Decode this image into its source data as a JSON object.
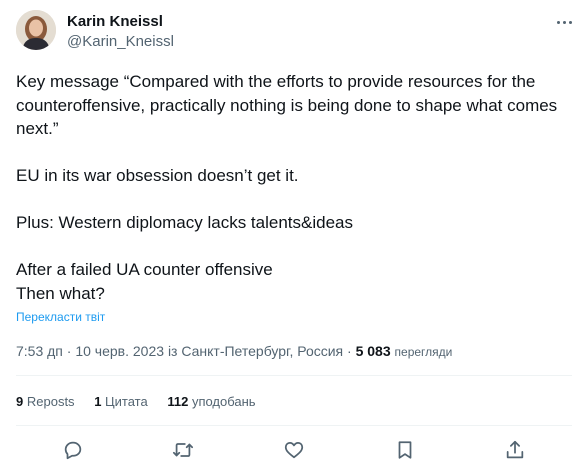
{
  "author": {
    "name": "Karin Kneissl",
    "handle": "@Karin_Kneissl"
  },
  "tweet": {
    "paragraphs": [
      "Key message “Compared with the efforts to provide resources for the counteroffensive, practically nothing is being done to shape what comes next.”",
      "EU in its war obsession doesn’t get it.",
      "Plus: Western diplomacy lacks talents&ideas",
      "After a failed UA counter offensive\nThen what?"
    ],
    "translate_link": "Перекласти твіт"
  },
  "meta": {
    "time": "7:53 дп",
    "date": "10 черв. 2023",
    "location": "із Санкт-Петербург, Россия",
    "separator": "·",
    "views_count": "5 083",
    "views_label": "перегляди"
  },
  "stats": {
    "reposts_count": "9",
    "reposts_label": "Reposts",
    "quotes_count": "1",
    "quotes_label": "Цитата",
    "likes_count": "112",
    "likes_label": "уподобань"
  },
  "actions": [
    "reply-icon",
    "retweet-icon",
    "like-icon",
    "bookmark-icon",
    "share-icon"
  ]
}
